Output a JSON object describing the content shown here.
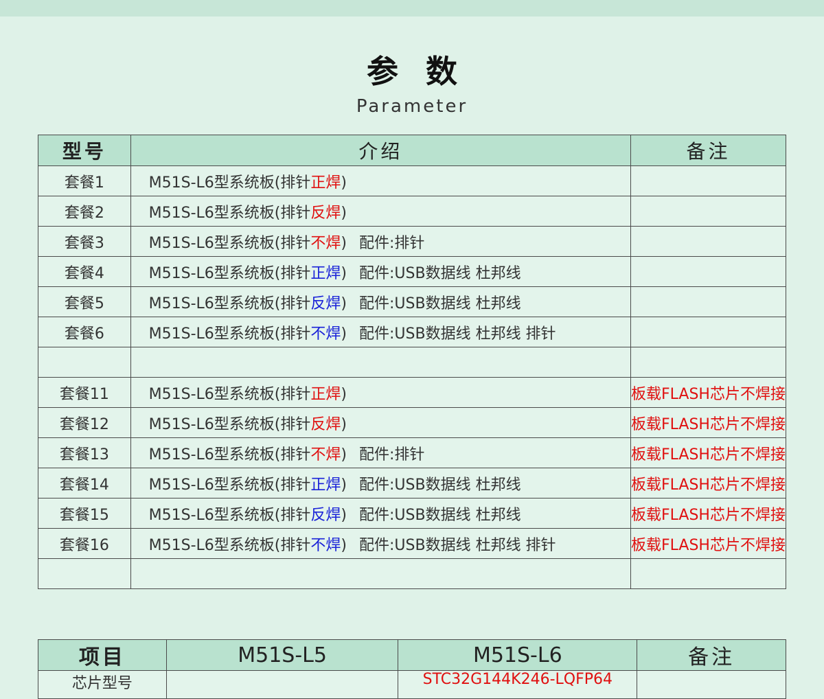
{
  "header": {
    "title": "参数",
    "subtitle": "Parameter"
  },
  "params_table": {
    "columns": [
      "型号",
      "介绍",
      "备注"
    ],
    "colors": {
      "red": "#e01010",
      "blue": "#1a22d8"
    },
    "rows": [
      {
        "model": "套餐1",
        "base": "M51S-L6型系统板(排针",
        "weld": "正焊",
        "weld_color": "red",
        "tail": ")",
        "accessory": "",
        "note": ""
      },
      {
        "model": "套餐2",
        "base": "M51S-L6型系统板(排针",
        "weld": "反焊",
        "weld_color": "red",
        "tail": ")",
        "accessory": "",
        "note": ""
      },
      {
        "model": "套餐3",
        "base": "M51S-L6型系统板(排针",
        "weld": "不焊",
        "weld_color": "red",
        "tail": ")",
        "accessory": "配件:排针",
        "note": ""
      },
      {
        "model": "套餐4",
        "base": "M51S-L6型系统板(排针",
        "weld": "正焊",
        "weld_color": "blue",
        "tail": ")",
        "accessory": "配件:USB数据线 杜邦线",
        "note": ""
      },
      {
        "model": "套餐5",
        "base": "M51S-L6型系统板(排针",
        "weld": "反焊",
        "weld_color": "blue",
        "tail": ")",
        "accessory": "配件:USB数据线 杜邦线",
        "note": ""
      },
      {
        "model": "套餐6",
        "base": "M51S-L6型系统板(排针",
        "weld": "不焊",
        "weld_color": "blue",
        "tail": ")",
        "accessory": "配件:USB数据线 杜邦线 排针",
        "note": ""
      },
      {
        "model": "",
        "base": "",
        "weld": "",
        "weld_color": "red",
        "tail": "",
        "accessory": "",
        "note": ""
      },
      {
        "model": "套餐11",
        "base": "M51S-L6型系统板(排针",
        "weld": "正焊",
        "weld_color": "red",
        "tail": ")",
        "accessory": "",
        "note": "板载FLASH芯片不焊接"
      },
      {
        "model": "套餐12",
        "base": "M51S-L6型系统板(排针",
        "weld": "反焊",
        "weld_color": "red",
        "tail": ")",
        "accessory": "",
        "note": "板载FLASH芯片不焊接"
      },
      {
        "model": "套餐13",
        "base": "M51S-L6型系统板(排针",
        "weld": "不焊",
        "weld_color": "red",
        "tail": ")",
        "accessory": "配件:排针",
        "note": "板载FLASH芯片不焊接"
      },
      {
        "model": "套餐14",
        "base": "M51S-L6型系统板(排针",
        "weld": "正焊",
        "weld_color": "blue",
        "tail": ")",
        "accessory": "配件:USB数据线 杜邦线",
        "note": "板载FLASH芯片不焊接"
      },
      {
        "model": "套餐15",
        "base": "M51S-L6型系统板(排针",
        "weld": "反焊",
        "weld_color": "blue",
        "tail": ")",
        "accessory": "配件:USB数据线 杜邦线",
        "note": "板载FLASH芯片不焊接"
      },
      {
        "model": "套餐16",
        "base": "M51S-L6型系统板(排针",
        "weld": "不焊",
        "weld_color": "blue",
        "tail": ")",
        "accessory": "配件:USB数据线 杜邦线 排针",
        "note": "板载FLASH芯片不焊接"
      },
      {
        "model": "",
        "base": "",
        "weld": "",
        "weld_color": "red",
        "tail": "",
        "accessory": "",
        "note": ""
      }
    ]
  },
  "spec_table": {
    "columns": [
      "项目",
      "M51S-L5",
      "M51S-L6",
      "备注"
    ],
    "rows": [
      {
        "item": "芯片型号",
        "l5": "",
        "l6": "STC32G144K246-LQFP64",
        "note": ""
      }
    ]
  }
}
